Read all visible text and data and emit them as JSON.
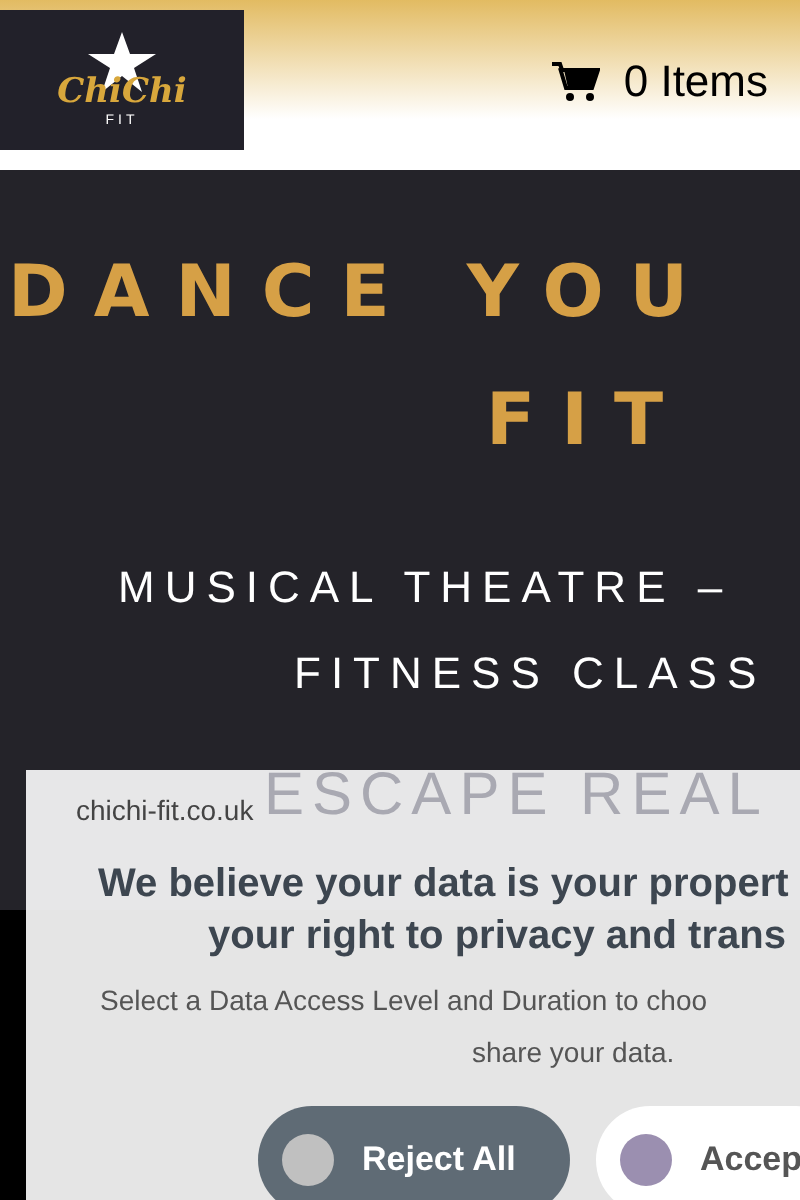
{
  "header": {
    "logo": {
      "name": "ChiChi",
      "sub": "FIT"
    },
    "cart": {
      "label": "0 Items"
    }
  },
  "hero": {
    "title": [
      "DANCE YOU",
      "FIT"
    ],
    "subtitle": [
      "MUSICAL THEATRE –",
      "FITNESS CLASS"
    ],
    "tagline": "ESCAPE REAL"
  },
  "consent": {
    "site": "chichi-fit.co.uk",
    "heading": [
      "We believe your data is your propert",
      "your right to privacy and trans"
    ],
    "body": [
      "Select a Data Access Level and Duration to choo",
      "share your data."
    ],
    "buttons": [
      {
        "label": "Reject All",
        "kind": "reject"
      },
      {
        "label": "Accep",
        "kind": "accept"
      }
    ]
  }
}
